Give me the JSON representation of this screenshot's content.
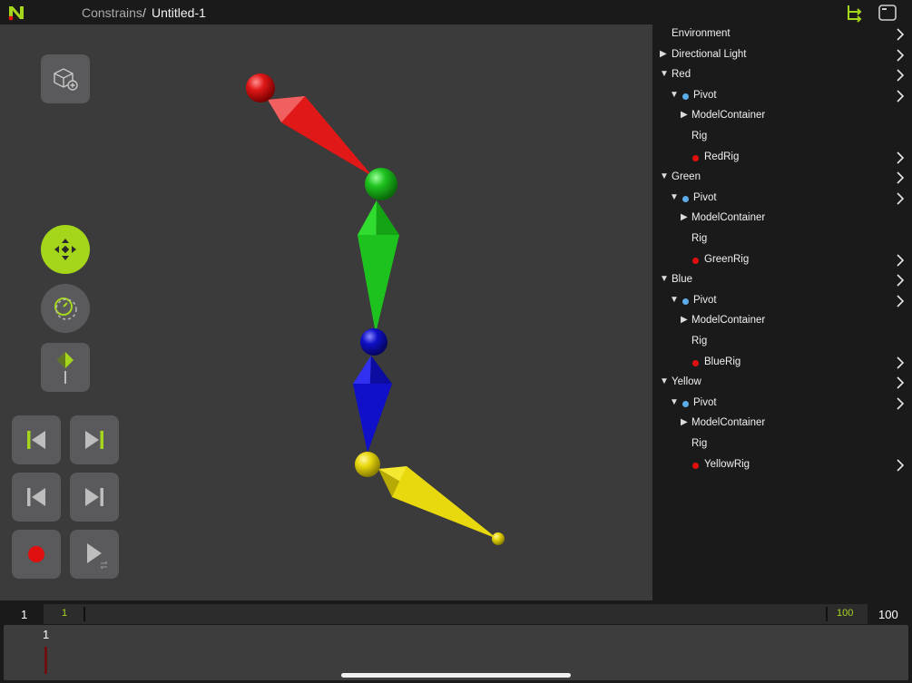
{
  "app": {
    "breadcrumb_project": "Constrains",
    "breadcrumb_separator": "/",
    "document_title": "Untitled-1",
    "accent_color": "#a6d61c"
  },
  "toolbar_left": {
    "buttons": [
      {
        "name": "add-object",
        "icon": "cube-add-icon"
      },
      {
        "name": "move-tool",
        "icon": "move-arrows-icon",
        "active": true
      },
      {
        "name": "rotate-tool",
        "icon": "rotate-icon"
      },
      {
        "name": "keyframe-tool",
        "icon": "keyframe-icon"
      }
    ],
    "playback": [
      {
        "name": "go-to-start",
        "icon": "skip-start-icon"
      },
      {
        "name": "go-to-end",
        "icon": "skip-end-icon"
      },
      {
        "name": "previous-key",
        "icon": "step-back-icon"
      },
      {
        "name": "next-key",
        "icon": "step-forward-icon"
      },
      {
        "name": "record",
        "icon": "record-icon",
        "color": "#e01010"
      },
      {
        "name": "play-loop",
        "icon": "play-loop-icon"
      }
    ]
  },
  "scene": {
    "joint_colors": {
      "red": "#e01818",
      "green": "#1ec21e",
      "blue": "#1010c8",
      "yellow": "#e8d80e"
    }
  },
  "hierarchy": [
    {
      "label": "Environment",
      "level": 0,
      "expander": "none",
      "dot": null,
      "chevron": true
    },
    {
      "label": "Directional Light",
      "level": 0,
      "expander": "collapsed",
      "dot": null,
      "chevron": true
    },
    {
      "label": "Red",
      "level": 0,
      "expander": "expanded",
      "dot": null,
      "chevron": true
    },
    {
      "label": "Pivot",
      "level": 1,
      "expander": "expanded",
      "dot": "#5aabe8",
      "chevron": true
    },
    {
      "label": "ModelContainer",
      "level": 2,
      "expander": "collapsed",
      "dot": null,
      "chevron": false
    },
    {
      "label": "Rig",
      "level": 2,
      "expander": "none",
      "dot": null,
      "chevron": false
    },
    {
      "label": "RedRig",
      "level": 2,
      "expander": "none",
      "dot": "#e01010",
      "chevron": true
    },
    {
      "label": "Green",
      "level": 0,
      "expander": "expanded",
      "dot": null,
      "chevron": true
    },
    {
      "label": "Pivot",
      "level": 1,
      "expander": "expanded",
      "dot": "#5aabe8",
      "chevron": true
    },
    {
      "label": "ModelContainer",
      "level": 2,
      "expander": "collapsed",
      "dot": null,
      "chevron": false
    },
    {
      "label": "Rig",
      "level": 2,
      "expander": "none",
      "dot": null,
      "chevron": false
    },
    {
      "label": "GreenRig",
      "level": 2,
      "expander": "none",
      "dot": "#e01010",
      "chevron": true
    },
    {
      "label": "Blue",
      "level": 0,
      "expander": "expanded",
      "dot": null,
      "chevron": true
    },
    {
      "label": "Pivot",
      "level": 1,
      "expander": "expanded",
      "dot": "#5aabe8",
      "chevron": true
    },
    {
      "label": "ModelContainer",
      "level": 2,
      "expander": "collapsed",
      "dot": null,
      "chevron": false
    },
    {
      "label": "Rig",
      "level": 2,
      "expander": "none",
      "dot": null,
      "chevron": false
    },
    {
      "label": "BlueRig",
      "level": 2,
      "expander": "none",
      "dot": "#e01010",
      "chevron": true
    },
    {
      "label": "Yellow",
      "level": 0,
      "expander": "expanded",
      "dot": null,
      "chevron": true
    },
    {
      "label": "Pivot",
      "level": 1,
      "expander": "expanded",
      "dot": "#5aabe8",
      "chevron": true
    },
    {
      "label": "ModelContainer",
      "level": 2,
      "expander": "collapsed",
      "dot": null,
      "chevron": false
    },
    {
      "label": "Rig",
      "level": 2,
      "expander": "none",
      "dot": null,
      "chevron": false
    },
    {
      "label": "YellowRig",
      "level": 2,
      "expander": "none",
      "dot": "#e01010",
      "chevron": true
    }
  ],
  "timeline": {
    "start_frame": "1",
    "range_start": "1",
    "range_end": "100",
    "end_frame": "100",
    "current_frame": "1",
    "playhead_color": "#6b0f0f"
  }
}
